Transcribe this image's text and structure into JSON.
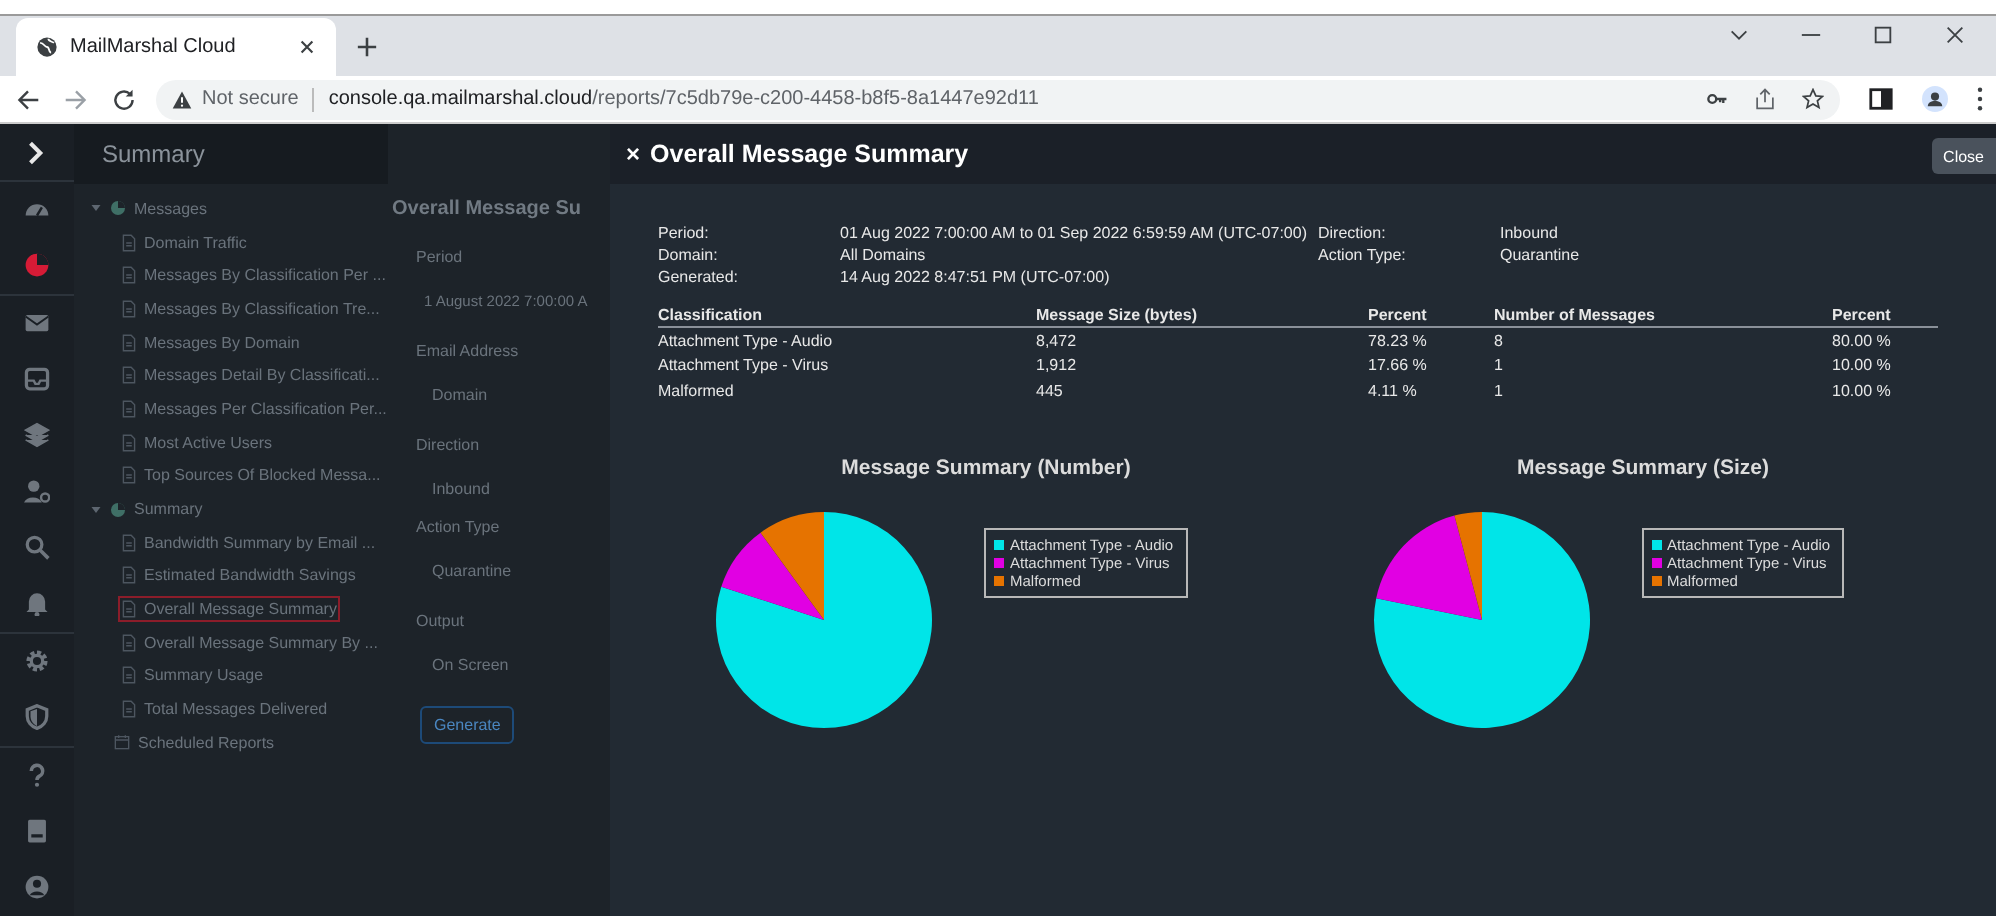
{
  "browser": {
    "tab_title": "MailMarshal Cloud",
    "security": "Not secure",
    "url_host": "console.qa.mailmarshal.cloud",
    "url_path": "/reports/7c5db79e-c200-4458-b8f5-8a1447e92d11"
  },
  "rail": [
    {
      "selected": false
    },
    {
      "selected": true
    },
    {
      "selected": false
    },
    {
      "selected": false
    },
    {
      "selected": false
    },
    {
      "selected": false
    },
    {
      "selected": false
    },
    {
      "selected": false
    },
    {
      "selected": false
    },
    {
      "selected": false
    },
    {
      "selected": false
    },
    {
      "selected": false
    },
    {
      "selected": false
    }
  ],
  "sidebar": {
    "title": "Summary",
    "tree": [
      {
        "label": "Messages",
        "expanded": true,
        "children": [
          {
            "label": "Domain Traffic",
            "selected": false
          },
          {
            "label": "Messages By Classification Per ...",
            "selected": false
          },
          {
            "label": "Messages By Classification Tre...",
            "selected": false
          },
          {
            "label": "Messages By Domain",
            "selected": false
          },
          {
            "label": "Messages Detail By Classificati...",
            "selected": false
          },
          {
            "label": "Messages Per Classification Per...",
            "selected": false
          },
          {
            "label": "Most Active Users",
            "selected": false
          },
          {
            "label": "Top Sources Of Blocked Messa...",
            "selected": false
          }
        ]
      },
      {
        "label": "Summary",
        "expanded": true,
        "children": [
          {
            "label": "Bandwidth Summary by Email ...",
            "selected": false
          },
          {
            "label": "Estimated Bandwidth Savings",
            "selected": false
          },
          {
            "label": "Overall Message Summary",
            "selected": true
          },
          {
            "label": "Overall Message Summary By ...",
            "selected": false
          },
          {
            "label": "Summary Usage",
            "selected": false
          },
          {
            "label": "Total Messages Delivered",
            "selected": false
          }
        ]
      }
    ],
    "scheduled": "Scheduled Reports"
  },
  "form": {
    "title": "Overall Message Su",
    "fields": [
      {
        "label": "Period",
        "value": "1 August 2022 7:00:00 A"
      },
      {
        "label": "Email Address",
        "value": "Domain"
      },
      {
        "label": "Direction",
        "value": "Inbound"
      },
      {
        "label": "Action Type",
        "value": "Quarantine"
      },
      {
        "label": "Output",
        "value": "On Screen"
      }
    ],
    "button": "Generate"
  },
  "modal": {
    "close_glyph": "×",
    "title": "Overall Message Summary",
    "close_button": "Close",
    "meta_left": [
      {
        "label": "Period:",
        "value": "01 Aug 2022 7:00:00 AM to 01 Sep 2022 6:59:59 AM (UTC-07:00)"
      },
      {
        "label": "Domain:",
        "value": "All Domains"
      },
      {
        "label": "Generated:",
        "value": "14 Aug 2022 8:47:51 PM (UTC-07:00)"
      }
    ],
    "meta_right": [
      {
        "label": "Direction:",
        "value": "Inbound"
      },
      {
        "label": "Action Type:",
        "value": "Quarantine"
      }
    ],
    "table": {
      "columns": [
        "Classification",
        "Message Size (bytes)",
        "Percent",
        "Number of Messages",
        "Percent"
      ],
      "rows": [
        [
          "Attachment Type - Audio",
          "8,472",
          "78.23 %",
          "8",
          "80.00 %"
        ],
        [
          "Attachment Type - Virus",
          "1,912",
          "17.66 %",
          "1",
          "10.00 %"
        ],
        [
          "Malformed",
          "445",
          "4.11 %",
          "1",
          "10.00 %"
        ]
      ]
    },
    "charts": [
      {
        "chart_data": {
          "type": "pie",
          "title": "Message Summary (Number)",
          "categories": [
            "Attachment Type - Audio",
            "Attachment Type - Virus",
            "Malformed"
          ],
          "values": [
            80,
            10,
            10
          ],
          "colors": [
            "#00e5e8",
            "#e100e3",
            "#e67300"
          ],
          "legend": "right"
        }
      },
      {
        "chart_data": {
          "type": "pie",
          "title": "Message Summary (Size)",
          "categories": [
            "Attachment Type - Audio",
            "Attachment Type - Virus",
            "Malformed"
          ],
          "values": [
            78.23,
            17.66,
            4.11
          ],
          "colors": [
            "#00e5e8",
            "#e100e3",
            "#e67300"
          ],
          "legend": "right"
        }
      }
    ]
  }
}
